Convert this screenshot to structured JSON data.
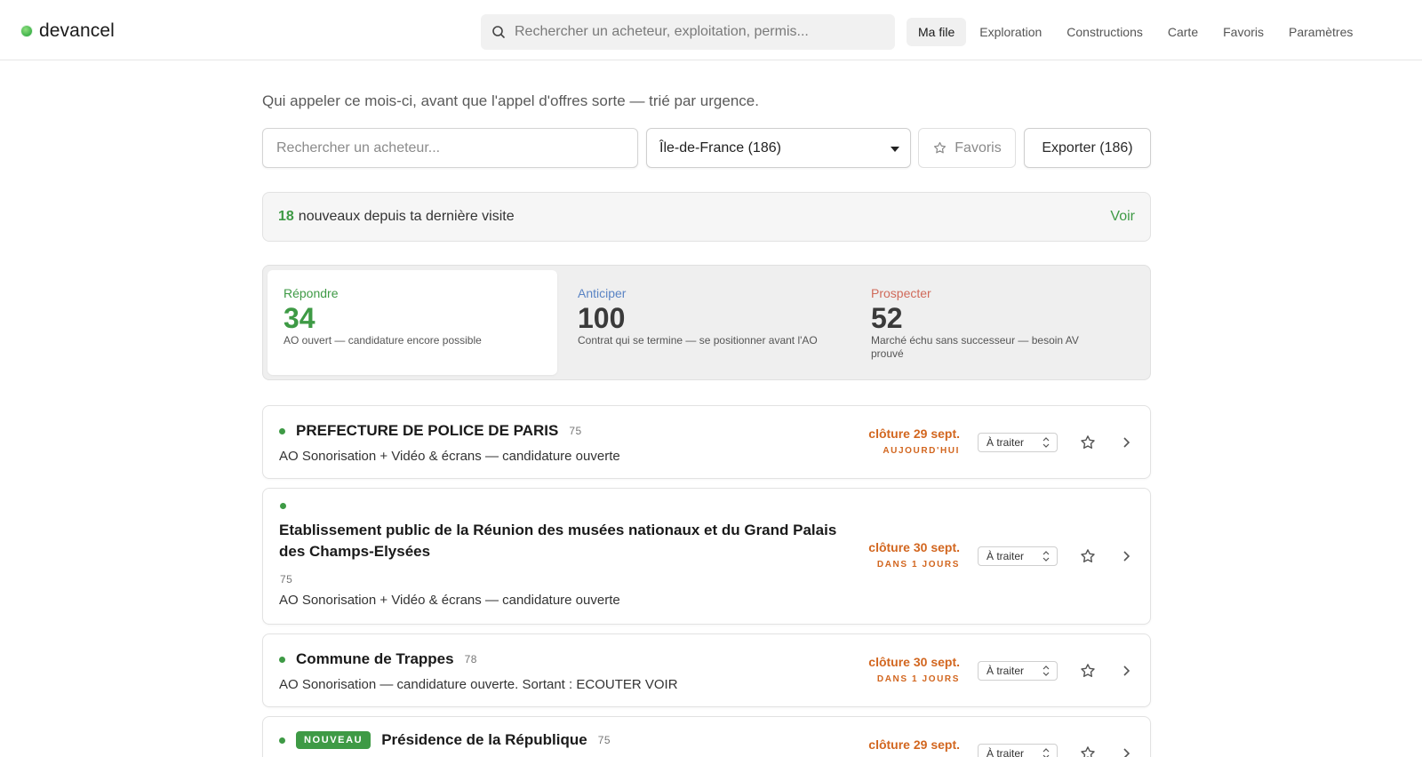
{
  "brand": {
    "name": "devancel"
  },
  "search": {
    "placeholder": "Rechercher un acheteur, exploitation, permis..."
  },
  "nav": {
    "items": [
      "Ma file",
      "Exploration",
      "Constructions",
      "Carte",
      "Favoris",
      "Paramètres"
    ],
    "active": "Ma file"
  },
  "page": {
    "subtitle": "Qui appeler ce mois-ci, avant que l'appel d'offres sorte — trié par urgence."
  },
  "filters": {
    "buyer_placeholder": "Rechercher un acheteur...",
    "region": "Île-de-France (186)",
    "favorites_label": "Favoris",
    "export_label": "Exporter (186)"
  },
  "news": {
    "count": "18",
    "text": "nouveaux depuis ta dernière visite",
    "action": "Voir"
  },
  "segments": [
    {
      "label": "Répondre",
      "count": "34",
      "description": "AO ouvert — candidature encore possible",
      "color": "#3e9a45"
    },
    {
      "label": "Anticiper",
      "count": "100",
      "description": "Contrat qui se termine — se positionner avant l'AO",
      "color": "#5a84c4"
    },
    {
      "label": "Prospecter",
      "count": "52",
      "description": "Marché échu sans successeur — besoin AV prouvé",
      "color": "#d06a5a"
    }
  ],
  "rows": [
    {
      "title": "PREFECTURE DE POLICE DE PARIS",
      "dept": "75",
      "description": "AO Sonorisation + Vidéo & écrans — candidature ouverte",
      "deadline": "clôture 29 sept.",
      "urgency": "AUJOURD'HUI",
      "status": "À traiter"
    },
    {
      "title": "Etablissement public de la Réunion des musées nationaux et du Grand Palais des Champs-Elysées",
      "dept": "75",
      "description": "AO Sonorisation + Vidéo & écrans — candidature ouverte",
      "deadline": "clôture 30 sept.",
      "urgency": "DANS 1 JOURS",
      "status": "À traiter"
    },
    {
      "title": "Commune de Trappes",
      "dept": "78",
      "description": "AO Sonorisation — candidature ouverte. Sortant : ECOUTER VOIR",
      "deadline": "clôture 30 sept.",
      "urgency": "DANS 1 JOURS",
      "status": "À traiter"
    },
    {
      "badge": "NOUVEAU",
      "title": "Présidence de la République",
      "dept": "75",
      "deadline": "clôture 29 sept.",
      "status": "À traiter"
    }
  ],
  "colors": {
    "accent": "#3e9a45",
    "deadline": "#d2661f"
  }
}
